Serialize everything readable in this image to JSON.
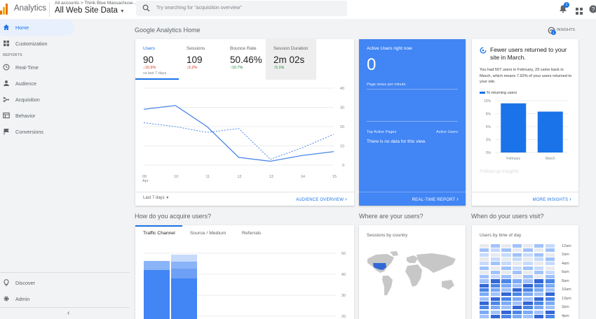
{
  "app": {
    "name": "Analytics"
  },
  "header": {
    "crumbs": "All accounts > Think Blue Massachuse...",
    "view": "All Web Site Data",
    "search_placeholder": "Try searching for \"acquisition overview\"",
    "notification_count": "1"
  },
  "sidebar": {
    "items": [
      {
        "label": "Home",
        "icon": "home-icon"
      },
      {
        "label": "Customization",
        "icon": "customization-icon"
      }
    ],
    "reports_label": "REPORTS",
    "reports": [
      {
        "label": "Real-Time",
        "icon": "clock-icon"
      },
      {
        "label": "Audience",
        "icon": "person-icon"
      },
      {
        "label": "Acquisition",
        "icon": "acquisition-icon"
      },
      {
        "label": "Behavior",
        "icon": "behavior-icon"
      },
      {
        "label": "Conversions",
        "icon": "flag-icon"
      }
    ],
    "bottom": [
      {
        "label": "Discover",
        "icon": "lightbulb-icon"
      },
      {
        "label": "Admin",
        "icon": "gear-icon"
      }
    ]
  },
  "main": {
    "title": "Google Analytics Home",
    "insights_label": "INSIGHTS",
    "insights_badge": "1"
  },
  "overview": {
    "tabs": [
      {
        "label": "Users",
        "value": "90",
        "delta": "↓10.9%",
        "delta_dir": "down",
        "sub": "vs last 7 days"
      },
      {
        "label": "Sessions",
        "value": "109",
        "delta": "↓5.2%",
        "delta_dir": "down"
      },
      {
        "label": "Bounce Rate",
        "value": "50.46%",
        "delta": "↑10.7%",
        "delta_dir": "up"
      },
      {
        "label": "Session Duration",
        "value": "2m 02s",
        "delta": "↑5.1%",
        "delta_dir": "up"
      }
    ],
    "date_range": "Last 7 days",
    "link": "AUDIENCE OVERVIEW"
  },
  "chart_data": {
    "type": "line",
    "x": [
      "09 Apr",
      "10",
      "11",
      "12",
      "13",
      "14",
      "15"
    ],
    "ylim": [
      0,
      40
    ],
    "yticks": [
      0,
      10,
      20,
      30,
      40
    ],
    "series": [
      {
        "style": "solid",
        "values": [
          29,
          31,
          20,
          4,
          2,
          5,
          7
        ]
      },
      {
        "style": "dashed",
        "values": [
          22,
          20,
          17,
          19,
          3,
          9,
          16
        ]
      }
    ],
    "grid": true
  },
  "realtime": {
    "title": "Active Users right now",
    "value": "0",
    "views_label": "Page views per minute",
    "top_pages": "Top Active Pages",
    "active_users": "Active Users",
    "empty": "There is no data for this view.",
    "link": "REAL-TIME REPORT",
    "color": "#4285f4"
  },
  "insight": {
    "title": "Fewer users returned to your site in March.",
    "body": "You had 507 users in February, 29 came back in March, which means 7.92% of your users returned to your site.",
    "legend": "% returning users",
    "categories": [
      "February",
      "March"
    ],
    "values": [
      9.5,
      7.9
    ],
    "yticks": [
      "10%",
      "8%",
      "5%",
      "3%",
      "0%"
    ],
    "ymax": 10,
    "follow_up": "Follow up Insights",
    "link": "MORE INSIGHTS"
  },
  "acquire": {
    "title": "How do you acquire users?",
    "tabs": [
      "Traffic Channel",
      "Source / Medium",
      "Referrals"
    ],
    "yticks": [
      "50",
      "40",
      "30",
      "20"
    ]
  },
  "where": {
    "title": "Where are your users?",
    "card_title": "Sessions by country"
  },
  "when": {
    "title": "When do your users visit?",
    "card_title": "Users by time of day",
    "times": [
      "12am",
      "2am",
      "4am",
      "6am",
      "8am",
      "10am",
      "12pm",
      "2pm",
      "4pm"
    ]
  }
}
